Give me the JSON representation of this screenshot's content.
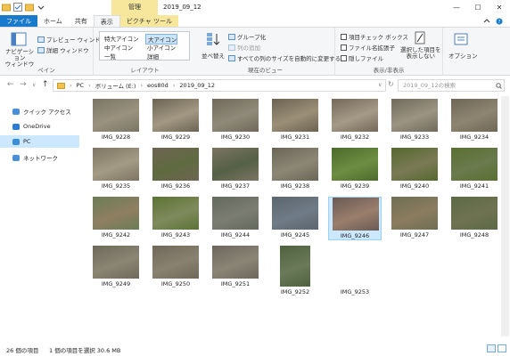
{
  "window": {
    "title": "2019_09_12",
    "context_tab": "管理",
    "minimize": "—",
    "maximize": "☐",
    "close": "✕"
  },
  "tabs": [
    {
      "label": "ファイル",
      "state": "file"
    },
    {
      "label": "ホーム",
      "state": ""
    },
    {
      "label": "共有",
      "state": ""
    },
    {
      "label": "表示",
      "state": "active"
    },
    {
      "label": "ピクチャ ツール",
      "state": "ctx"
    }
  ],
  "ribbon": {
    "panes": {
      "nav_pane": "ナビゲーション\nウィンドウ",
      "preview": "プレビュー ウィンドウ",
      "details": "詳細 ウィンドウ",
      "label": "ペイン"
    },
    "layout": {
      "items": [
        "特大アイコン",
        "大アイコン",
        "中アイコン",
        "小アイコン",
        "一覧",
        "詳細"
      ],
      "selected": "大アイコン",
      "label": "レイアウト"
    },
    "current_view": {
      "sort": "並べ替え",
      "group": "グループ化",
      "add_column": "列の追加",
      "fit_columns": "すべての列のサイズを自動的に変更する",
      "label": "現在のビュー"
    },
    "show_hide": {
      "item_checkbox": "項目チェック ボックス",
      "extensions": "ファイル名拡張子",
      "hidden": "隠しファイル",
      "hide_selected": "選択した項目を\n表示しない",
      "label": "表示/非表示"
    },
    "options": "オプション"
  },
  "address": {
    "parts": [
      "PC",
      "ボリューム (E:)",
      "eos80d",
      "2019_09_12"
    ],
    "search_placeholder": "2019_09_12の検索"
  },
  "nav": {
    "items": [
      {
        "label": "クイック アクセス",
        "icon": "star-icon",
        "selected": false
      },
      {
        "label": "OneDrive",
        "icon": "cloud-icon",
        "selected": false
      },
      {
        "label": "PC",
        "icon": "pc-icon",
        "selected": true
      },
      {
        "label": "ネットワーク",
        "icon": "network-icon",
        "selected": false
      }
    ]
  },
  "files": [
    {
      "name": "IMG_9228",
      "c": [
        "#7a7566",
        "#9a927e"
      ]
    },
    {
      "name": "IMG_9229",
      "c": [
        "#6c6353",
        "#a29883"
      ]
    },
    {
      "name": "IMG_9230",
      "c": [
        "#71695a",
        "#8f8a79"
      ]
    },
    {
      "name": "IMG_9231",
      "c": [
        "#6b6251",
        "#9b8f77"
      ]
    },
    {
      "name": "IMG_9232",
      "c": [
        "#74695a",
        "#a59a86"
      ]
    },
    {
      "name": "IMG_9233",
      "c": [
        "#6f6a5c",
        "#9c9482"
      ]
    },
    {
      "name": "IMG_9234",
      "c": [
        "#6e6756",
        "#8e8571"
      ]
    },
    {
      "name": "IMG_9235",
      "c": [
        "#7d7462",
        "#a49b85"
      ]
    },
    {
      "name": "IMG_9236",
      "c": [
        "#6d6552",
        "#5f6a40"
      ]
    },
    {
      "name": "IMG_9237",
      "c": [
        "#7b7563",
        "#556045"
      ]
    },
    {
      "name": "IMG_9238",
      "c": [
        "#6a6657",
        "#8c8775"
      ]
    },
    {
      "name": "IMG_9239",
      "c": [
        "#4b6b2c",
        "#6e8d43"
      ]
    },
    {
      "name": "IMG_9240",
      "c": [
        "#55682e",
        "#7a7a55"
      ]
    },
    {
      "name": "IMG_9241",
      "c": [
        "#5a7032",
        "#6a7a4d"
      ]
    },
    {
      "name": "IMG_9242",
      "c": [
        "#6b7d55",
        "#8f7f61"
      ]
    },
    {
      "name": "IMG_9243",
      "c": [
        "#5b7334",
        "#7f8a5d"
      ]
    },
    {
      "name": "IMG_9244",
      "c": [
        "#646a5d",
        "#7b7d72"
      ]
    },
    {
      "name": "IMG_9245",
      "c": [
        "#5c6570",
        "#6f7b86"
      ]
    },
    {
      "name": "IMG_9246",
      "c": [
        "#6a5a55",
        "#9a7e6c"
      ]
    },
    {
      "name": "IMG_9247",
      "c": [
        "#6f6e55",
        "#8b7c5f"
      ]
    },
    {
      "name": "IMG_9248",
      "c": [
        "#5d6a45",
        "#6f7252"
      ]
    },
    {
      "name": "IMG_9249",
      "c": [
        "#6f695b",
        "#8b8574"
      ]
    },
    {
      "name": "IMG_9250",
      "c": [
        "#6e675a",
        "#8a8270"
      ]
    },
    {
      "name": "IMG_9251",
      "c": [
        "#6b675c",
        "#8b8576"
      ]
    },
    {
      "name": "IMG_9252",
      "c": [
        "#4f6240",
        "#6a7a58"
      ]
    },
    {
      "name": "IMG_9253",
      "c": [
        "#ffffff",
        "#ffffff"
      ]
    }
  ],
  "selected_file": "IMG_9246",
  "status": {
    "count": "26 個の項目",
    "selection": "1 個の項目を選択  30.6 MB"
  }
}
